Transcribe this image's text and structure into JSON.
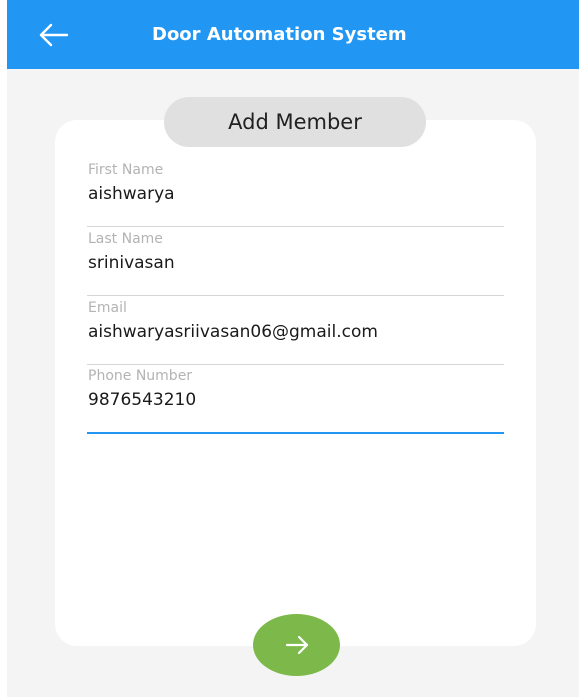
{
  "app_bar": {
    "title": "Door Automation System",
    "color": "#2196f3",
    "back_icon": "arrow-left-icon"
  },
  "card": {
    "title": "Add Member"
  },
  "form": {
    "fields": [
      {
        "label": "First Name",
        "value": "aishwarya"
      },
      {
        "label": "Last Name",
        "value": "srinivasan"
      },
      {
        "label": "Email",
        "value": "aishwaryasriivasan06@gmail.com"
      },
      {
        "label": "Phone Number",
        "value": "9876543210"
      }
    ],
    "active_field": "Phone Number"
  },
  "submit": {
    "icon": "arrow-right-icon",
    "color": "#7cb94a"
  }
}
